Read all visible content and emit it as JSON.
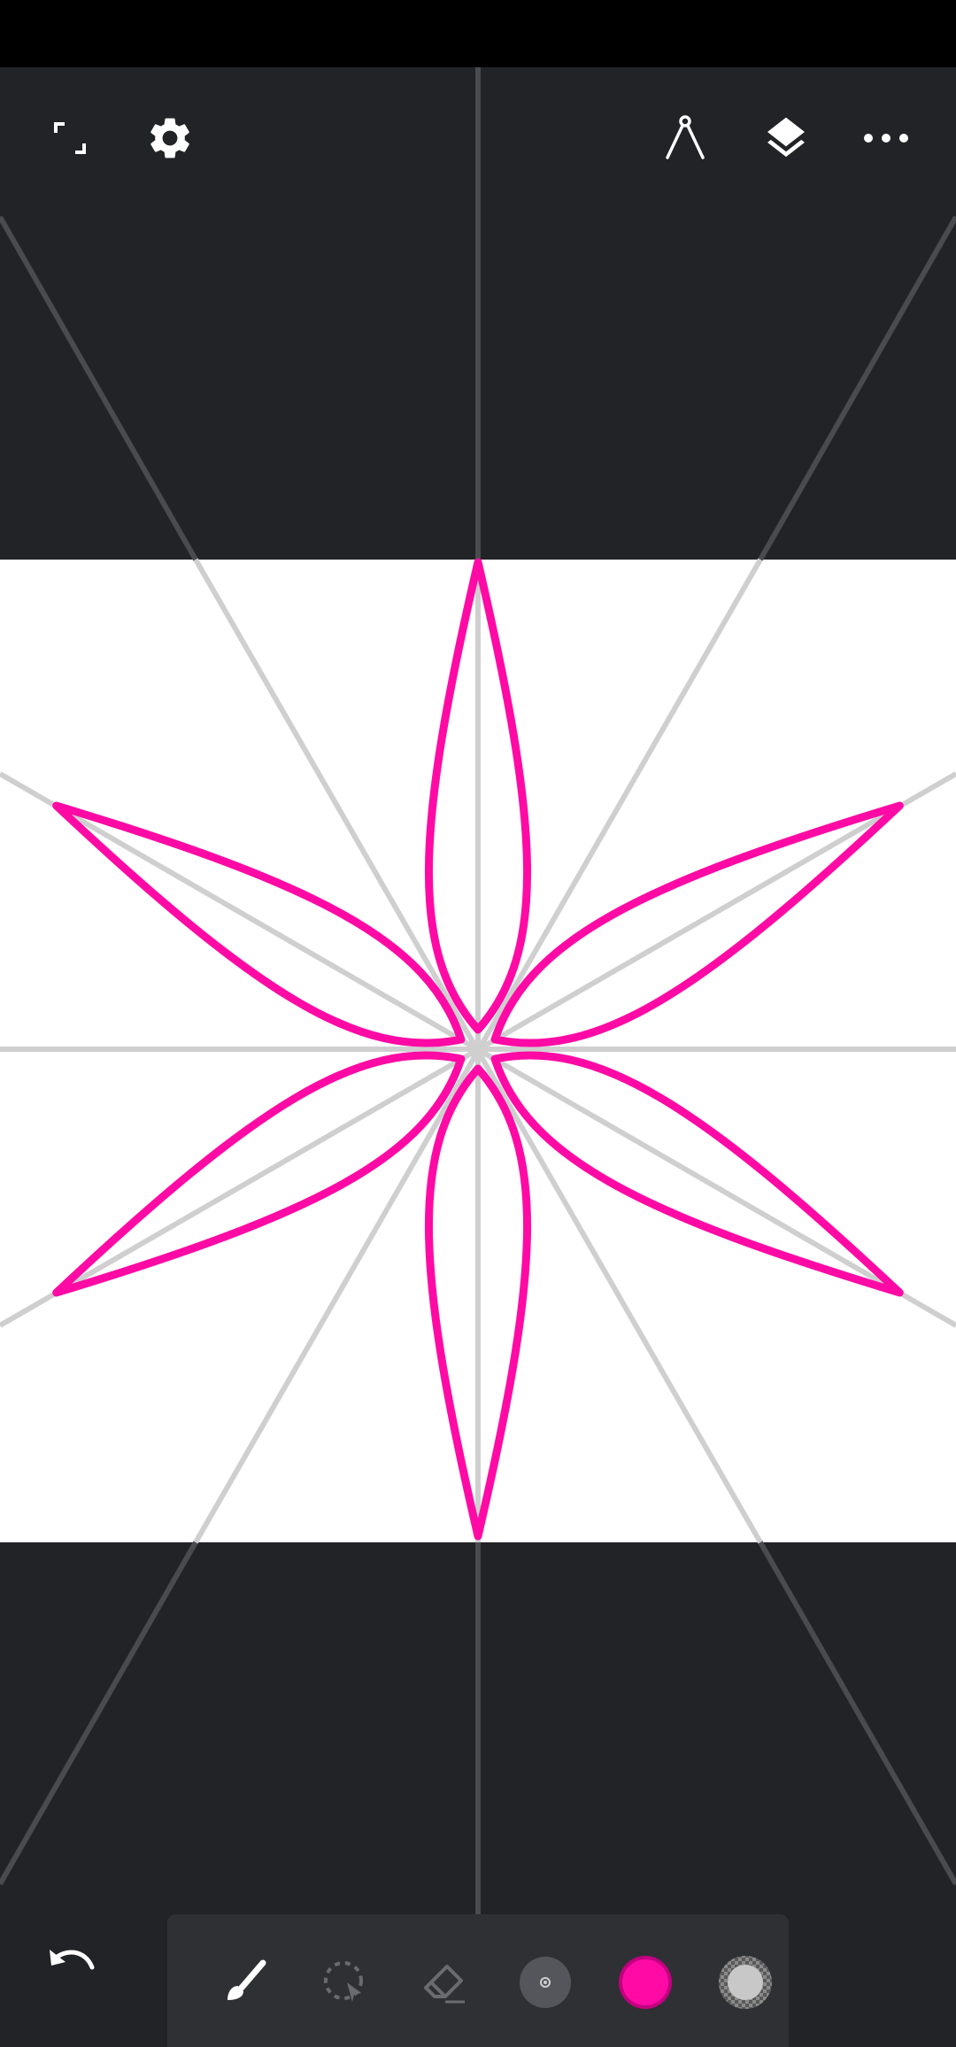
{
  "app": {
    "canvas": {
      "background": "#ffffff",
      "workspace_background": "#222326",
      "guide_color_on_canvas": "#cfcfcf",
      "guide_color_outside": "#4a4b4f",
      "symmetry": {
        "mode": "radial",
        "axes": 6
      },
      "stroke_color": "#ff0aa5"
    },
    "top_bar": {
      "left_icons": [
        "fullscreen-icon",
        "settings-gear-icon"
      ],
      "right_icons": [
        "ruler-compass-icon",
        "layers-icon",
        "more-options-icon"
      ]
    },
    "bottom_bar": {
      "undo_icon": "undo-icon",
      "tools": [
        "brush-icon",
        "lasso-select-icon",
        "eraser-icon",
        "brush-size-icon",
        "color-swatch",
        "opacity-swatch"
      ],
      "selected_tool": "brush-icon",
      "current_color": "#ff0aa5",
      "opacity_color": "#c8c8c8"
    }
  }
}
